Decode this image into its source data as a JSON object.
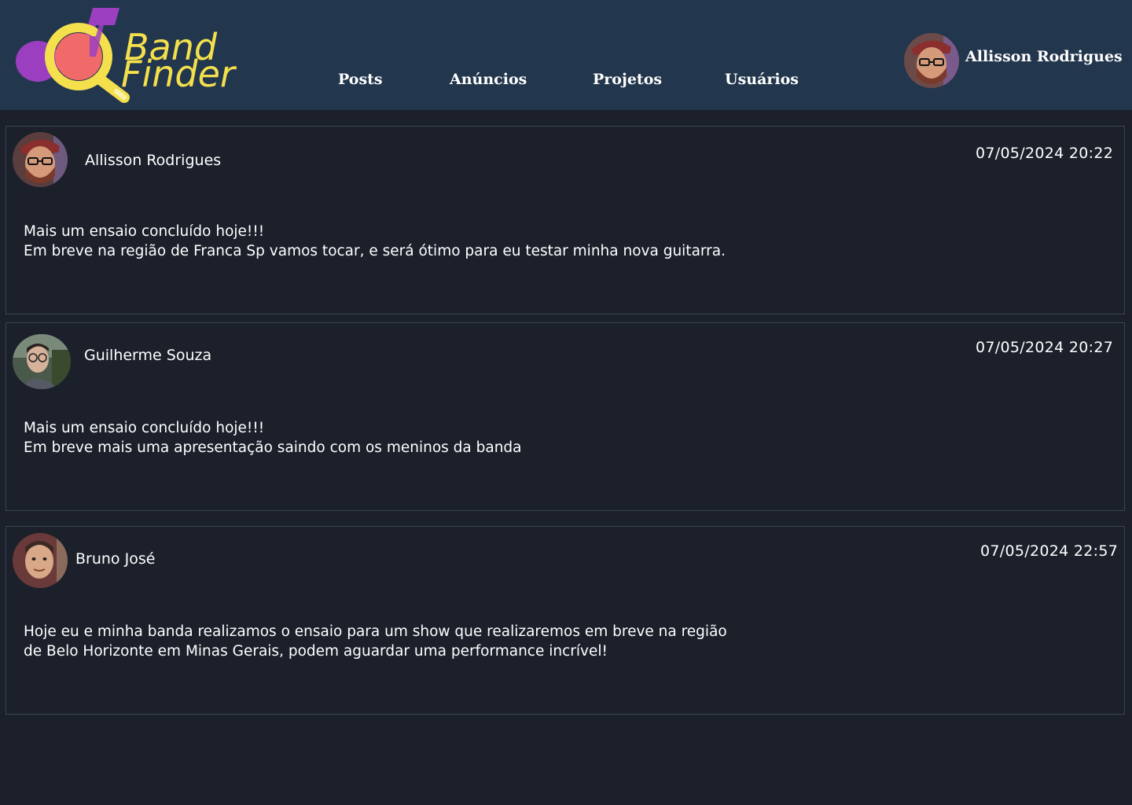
{
  "header": {
    "logo": {
      "line1": "Band",
      "line2": "Finder",
      "icon": "magnifier-music-note-logo"
    },
    "nav": [
      {
        "label": "Posts"
      },
      {
        "label": "Anúncios"
      },
      {
        "label": "Projetos"
      },
      {
        "label": "Usuários"
      }
    ],
    "user": {
      "name": "Allisson Rodrigues",
      "avatar": "avatar-allisson-icon"
    }
  },
  "posts": [
    {
      "author": "Allisson Rodrigues",
      "timestamp": "07/05/2024 20:22",
      "lines": [
        "Mais um ensaio concluído hoje!!!",
        "Em breve na região de Franca Sp vamos tocar, e será ótimo para eu testar minha nova guitarra."
      ]
    },
    {
      "author": "Guilherme Souza",
      "timestamp": "07/05/2024 20:27",
      "lines": [
        "Mais um ensaio concluído hoje!!!",
        "Em breve mais uma apresentação saindo com os meninos da banda"
      ]
    },
    {
      "author": "Bruno José",
      "timestamp": "07/05/2024 22:57",
      "lines": [
        "Hoje eu e minha banda realizamos o ensaio para um show que realizaremos em breve na região",
        "de Belo Horizonte em Minas Gerais, podem aguardar uma performance incrível!"
      ]
    }
  ],
  "colors": {
    "header_bg": "#22364d",
    "page_bg": "#1b202b",
    "logo_yellow": "#f4e04d",
    "logo_purple": "#9b3fc0",
    "logo_coral": "#f06a6a"
  }
}
